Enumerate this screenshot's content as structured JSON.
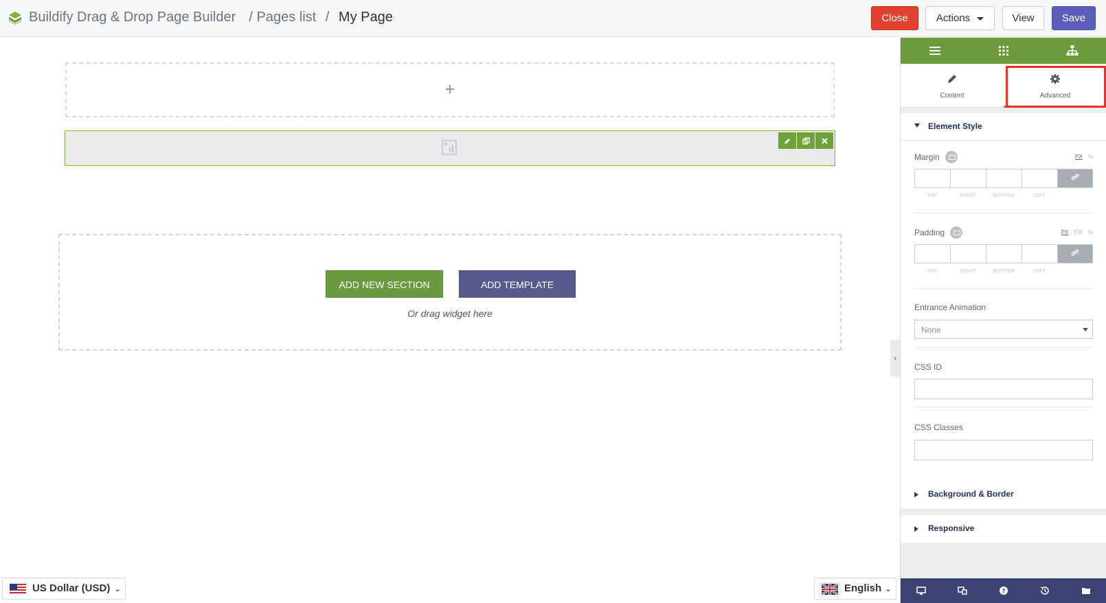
{
  "header": {
    "app_title": "Buildify Drag & Drop Page Builder",
    "crumb_pages": "/ Pages list",
    "crumb_sep": "/",
    "crumb_current": "My Page",
    "close_label": "Close",
    "actions_label": "Actions",
    "view_label": "View",
    "save_label": "Save"
  },
  "canvas": {
    "add_section_label": "ADD NEW SECTION",
    "add_template_label": "ADD TEMPLATE",
    "drag_hint": "Or drag widget here",
    "plus_glyph": "+"
  },
  "footer_left": {
    "currency": "US Dollar (USD)"
  },
  "footer_right": {
    "language": "English"
  },
  "panel": {
    "tabs": [
      {
        "label": "Content",
        "icon": "pencil-icon"
      },
      {
        "label": "Advanced",
        "icon": "gear-icon"
      }
    ],
    "element_style": {
      "title": "Element Style",
      "margin_label": "Margin",
      "margin_units": [
        "PX",
        "%"
      ],
      "padding_label": "Padding",
      "padding_units": [
        "PX",
        "EM",
        "%"
      ],
      "dim_labels": [
        "TOP",
        "RIGHT",
        "BOTTOM",
        "LEFT"
      ],
      "animation_label": "Entrance Animation",
      "animation_value": "None",
      "css_id_label": "CSS ID",
      "css_classes_label": "CSS Classes"
    },
    "background_border_title": "Background & Border",
    "responsive_title": "Responsive"
  },
  "colors": {
    "accent_green": "#6d9b3c",
    "close_red": "#e3412f",
    "save_purple": "#5b5fbb",
    "panel_footer": "#3c4372",
    "highlight": "#f0301b"
  }
}
